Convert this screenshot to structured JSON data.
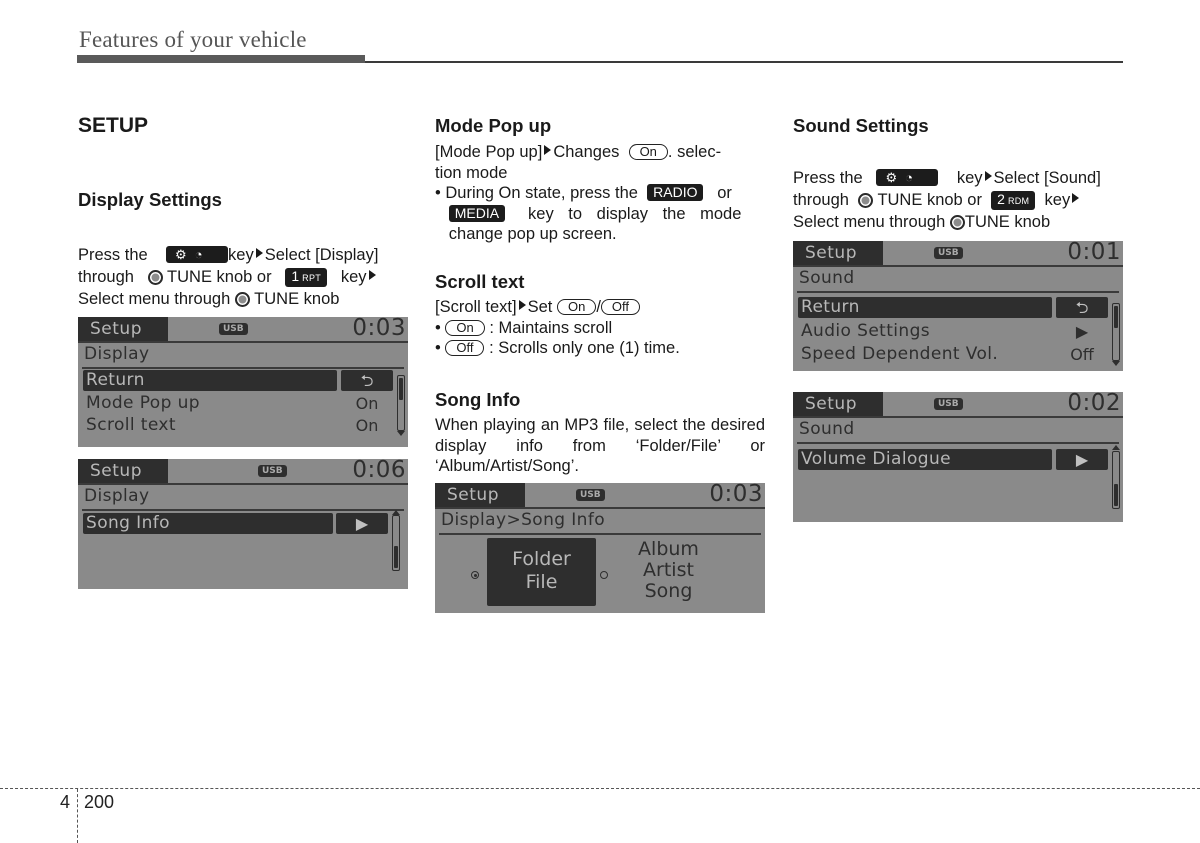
{
  "header": {
    "title": "Features of your vehicle"
  },
  "col1": {
    "section_title": "SETUP",
    "subsection_title": "Display Settings",
    "instruction": {
      "press_the": "Press the",
      "setup_key_glyphs": [
        "⚙",
        "🕑"
      ],
      "key_select": "key",
      "select_display": "Select [Display]",
      "through": "through",
      "tune_knob": "TUNE knob or",
      "rpt_key_num": "1",
      "rpt_key_label": "RPT",
      "key_after": "key",
      "select_menu": "Select menu through",
      "tune_knob_2": "TUNE knob"
    },
    "screen1": {
      "tab": "Setup",
      "usb": "USB",
      "time": "0:03",
      "crumb": "Display",
      "rows": [
        {
          "label": "Return",
          "value": "⮌",
          "selected": true
        },
        {
          "label": "Mode Pop up",
          "value": "On",
          "selected": false
        },
        {
          "label": "Scroll text",
          "value": "On",
          "selected": false
        }
      ]
    },
    "screen2": {
      "tab": "Setup",
      "usb": "USB",
      "time": "0:06",
      "crumb": "Display",
      "rows": [
        {
          "label": "Song Info",
          "value": "▶",
          "selected": true
        }
      ]
    }
  },
  "col2": {
    "mode_popup": {
      "title": "Mode Pop up",
      "line1_pre": "[Mode Pop up]",
      "line1_changes": "Changes",
      "on_pill": "On",
      "line1_post": ". selec-",
      "line2": "tion mode",
      "bullet_pre": "• During On state, press the",
      "radio_key": "RADIO",
      "or": "or",
      "media_key": "MEDIA",
      "bullet_post": "key to display the mode",
      "bullet_post2": "change pop up screen."
    },
    "scroll_text": {
      "title": "Scroll text",
      "line_pre": "[Scroll text]",
      "set": "Set",
      "on_pill": "On",
      "slash": "/",
      "off_pill": "Off",
      "bullet_on_desc": ": Maintains scroll",
      "bullet_off_desc": ": Scrolls only one (1) time."
    },
    "song_info": {
      "title": "Song Info",
      "body": "When playing an MP3 file, select the desired display info from ‘Folder/File’ or ‘Album/Artist/Song’."
    },
    "screen3": {
      "tab": "Setup",
      "usb": "USB",
      "time": "0:03",
      "crumb": "Display>Song Info",
      "option1": [
        "Folder",
        "File"
      ],
      "option2": [
        "Album",
        "Artist",
        "Song"
      ],
      "selected_option": 1
    }
  },
  "col3": {
    "sound_settings": {
      "title": "Sound Settings",
      "press_the": "Press the",
      "key_select": "key",
      "select_sound": "Select [Sound]",
      "through": "through",
      "tune_knob": "TUNE knob or",
      "rdm_key_num": "2",
      "rdm_key_label": "RDM",
      "key_after": "key",
      "select_menu": "Select menu through",
      "tune_knob_2": "TUNE knob"
    },
    "screen4": {
      "tab": "Setup",
      "usb": "USB",
      "time": "0:01",
      "crumb": "Sound",
      "rows": [
        {
          "label": "Return",
          "value": "⮌",
          "selected": true
        },
        {
          "label": "Audio Settings",
          "value": "▶",
          "selected": false
        },
        {
          "label": "Speed Dependent Vol.",
          "value": "Off",
          "selected": false
        }
      ]
    },
    "screen5": {
      "tab": "Setup",
      "usb": "USB",
      "time": "0:02",
      "crumb": "Sound",
      "rows": [
        {
          "label": "Volume Dialogue",
          "value": "▶",
          "selected": true
        }
      ]
    }
  },
  "footer": {
    "chapter": "4",
    "page": "200"
  }
}
